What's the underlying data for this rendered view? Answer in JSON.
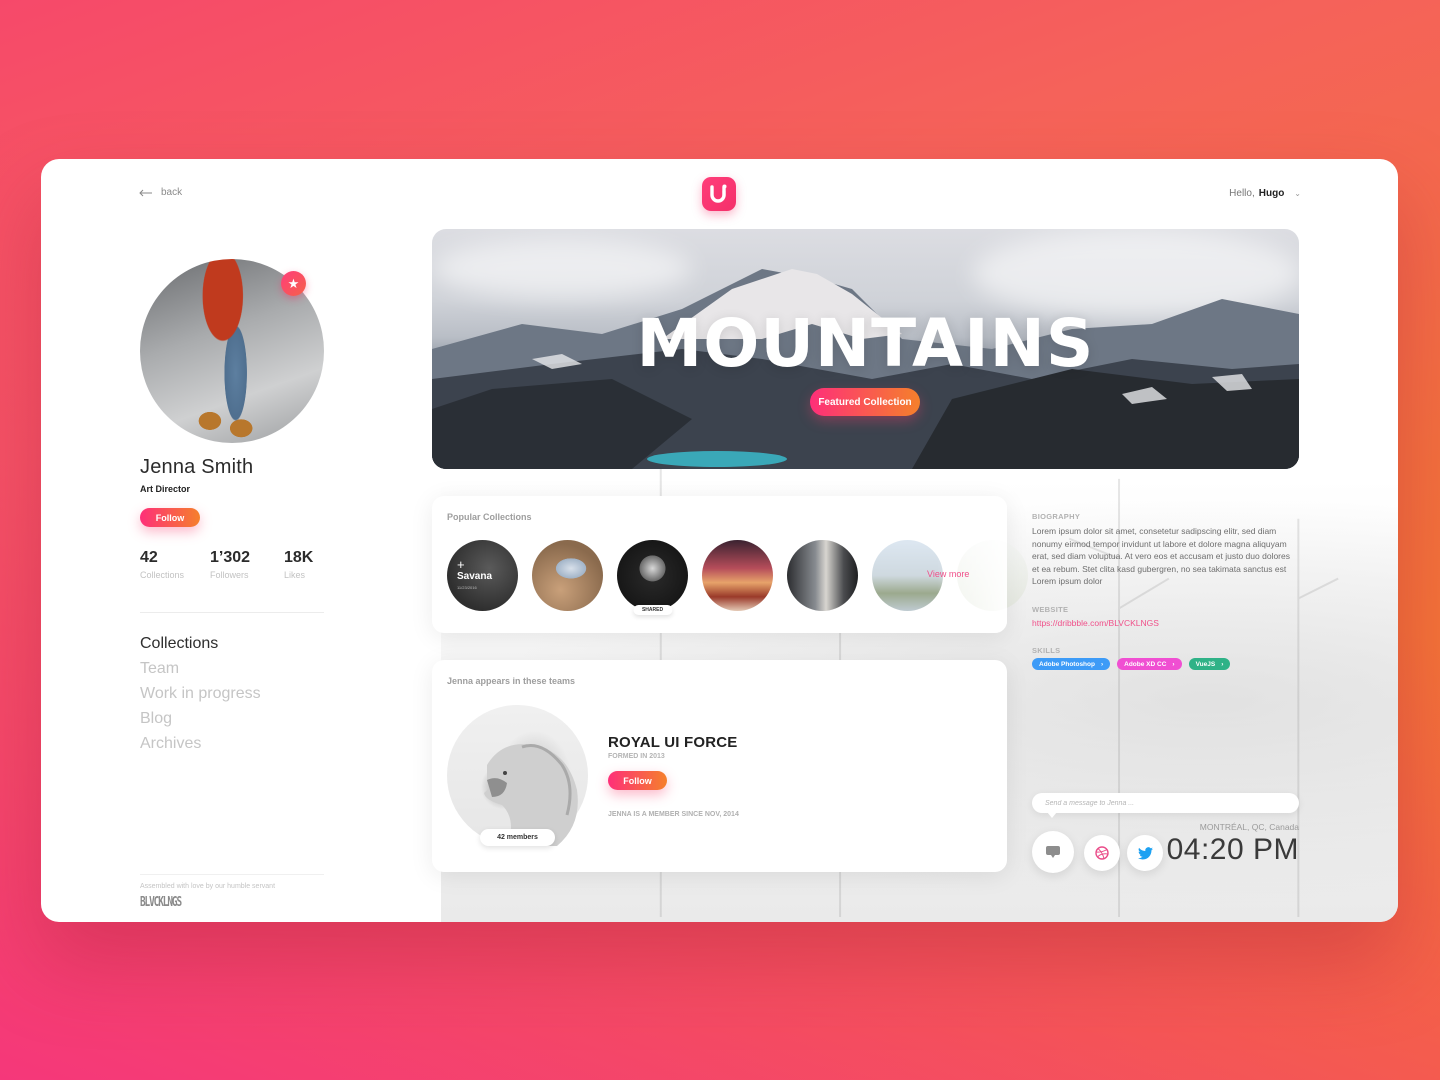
{
  "header": {
    "back_label": "back",
    "greeting": "Hello,",
    "user_name": "Hugo",
    "logo_letters": "UI"
  },
  "profile": {
    "name": "Jenna Smith",
    "role": "Art Director",
    "follow_label": "Follow",
    "stats": [
      {
        "value": "42",
        "label": "Collections"
      },
      {
        "value": "1’302",
        "label": "Followers"
      },
      {
        "value": "18K",
        "label": "Likes"
      }
    ]
  },
  "nav": {
    "items": [
      {
        "label": "Collections",
        "active": true
      },
      {
        "label": "Team",
        "active": false
      },
      {
        "label": "Work in progress",
        "active": false
      },
      {
        "label": "Blog",
        "active": false
      },
      {
        "label": "Archives",
        "active": false
      }
    ]
  },
  "footer": {
    "credit": "Assembled with love by our humble servant",
    "brand": "BLVCKLNGS"
  },
  "hero": {
    "title": "MOUNTAINS",
    "button_label": "Featured Collection"
  },
  "popular": {
    "title": "Popular Collections",
    "first_collection": {
      "name": "Savana",
      "date": "11/23/2016",
      "plus": "+"
    },
    "shared_label": "SHARED",
    "view_more_label": "View more"
  },
  "teams": {
    "title": "Jenna appears in these teams",
    "members_label": "42 members",
    "team_name": "ROYAL UI FORCE",
    "formed": "FORMED IN 2013",
    "follow_label": "Follow",
    "member_since": "JENNA IS A MEMBER SINCE NOV, 2014"
  },
  "about": {
    "biography_label": "BIOGRAPHY",
    "biography": "Lorem ipsum dolor sit amet, consetetur sadipscing elitr, sed diam nonumy eirmod tempor invidunt ut labore et dolore magna aliquyam erat, sed diam voluptua. At vero eos et accusam et justo duo dolores et ea rebum. Stet clita kasd gubergren, no sea takimata sanctus est Lorem ipsum dolor",
    "website_label": "WEBSITE",
    "website": "https://dribbble.com/BLVCKLNGS",
    "skills_label": "SKILLS",
    "skills": [
      {
        "label": "Adobe Photoshop",
        "color": "#3d9bf7"
      },
      {
        "label": "Adobe XD CC",
        "color": "#f04fd2"
      },
      {
        "label": "VueJS",
        "color": "#2fb287"
      }
    ]
  },
  "contact": {
    "message_placeholder": "Send a message to Jenna ...",
    "location": "MONTRÉAL, QC, Canada",
    "time": "04:20 PM"
  },
  "colors": {
    "accent_pink": "#fe2f79",
    "accent_orange": "#f5802b",
    "link": "#f0508a",
    "dribbble": "#ea4c89",
    "twitter": "#1da1f2"
  }
}
